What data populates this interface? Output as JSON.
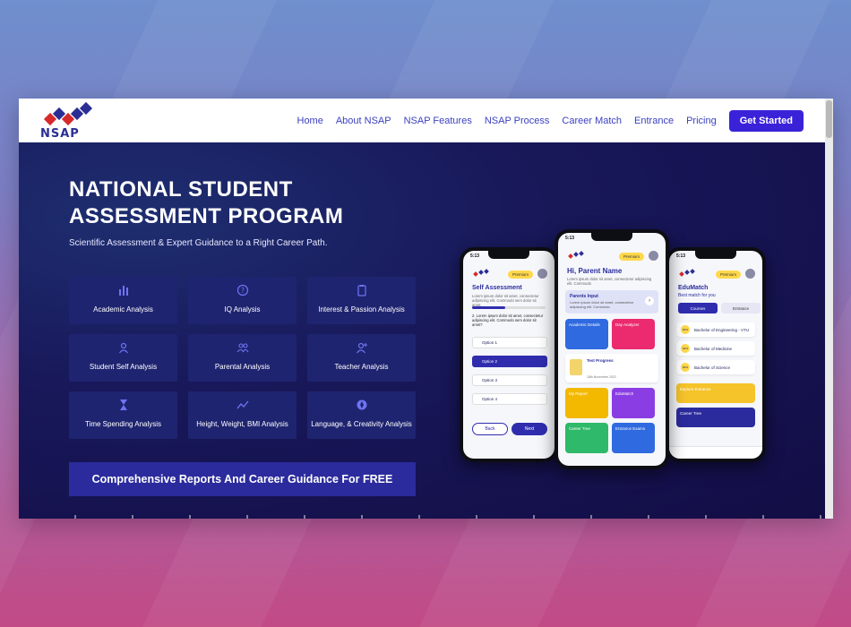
{
  "nav": {
    "logo_text": "NSAP",
    "links": [
      "Home",
      "About NSAP",
      "NSAP Features",
      "NSAP Process",
      "Career Match",
      "Entrance",
      "Pricing"
    ],
    "cta": "Get Started"
  },
  "hero": {
    "title_line1": "NATIONAL STUDENT",
    "title_line2": "ASSESSMENT PROGRAM",
    "subtitle": "Scientific Assessment & Expert Guidance to a Right Career Path.",
    "features": [
      {
        "label": "Academic Analysis",
        "icon": "bar-chart-icon"
      },
      {
        "label": "IQ Analysis",
        "icon": "question-circle-icon"
      },
      {
        "label": "Interest & Passion Analysis",
        "icon": "clipboard-icon"
      },
      {
        "label": "Student Self Analysis",
        "icon": "user-icon"
      },
      {
        "label": "Parental Analysis",
        "icon": "users-icon"
      },
      {
        "label": "Teacher Analysis",
        "icon": "user-add-icon"
      },
      {
        "label": "Time Spending Analysis",
        "icon": "hourglass-icon"
      },
      {
        "label": "Height, Weight, BMI Analysis",
        "icon": "trend-line-icon"
      },
      {
        "label": "Language, & Creativity Analysis",
        "icon": "compass-icon"
      }
    ],
    "banner": "Comprehensive Reports And Career Guidance For FREE"
  },
  "phones": {
    "left": {
      "time": "5:13",
      "badge": "Premium",
      "title": "Self Assessment",
      "intro": "Lorem ipsum dolor sit amet, consectetur adipiscing elit. Commodo sem dolor sit amet.",
      "question": "2. Lorem ipsum dolor sit amet, consectetur adipiscing elit. Commodo sem dolor sit amet?",
      "options": [
        "Option 1",
        "Option 2",
        "Option 3",
        "Option 4"
      ],
      "back": "Back",
      "next": "Next"
    },
    "center": {
      "time": "5:13",
      "badge": "Premium",
      "title": "Hi, Parent Name",
      "intro": "Lorem ipsum dolor sit amet, consectetur adipiscing elit. Commodo",
      "parents_input": "Parents Input",
      "parents_text": "Lorem ipsum dolor sit amet, consectetur adipiscing elit. Commodo",
      "cards": [
        "Academic Details",
        "Day Analyzer",
        "Test Progress",
        "My Report",
        "EduMatch",
        "Career Tree",
        "Entrance Exams"
      ],
      "progress_date": "18th November 2022"
    },
    "right": {
      "time": "5:13",
      "badge": "Premium",
      "title": "EduMatch",
      "subtitle": "Best match for you",
      "tabs": [
        "Courses",
        "Entrance"
      ],
      "items": [
        "Bachelor of Engineering - VTU",
        "Bachelor of Medicine",
        "Bachelor of Science"
      ],
      "explore": "Explore Entrance",
      "career": "Career Tree",
      "match_pct": "94%"
    }
  }
}
